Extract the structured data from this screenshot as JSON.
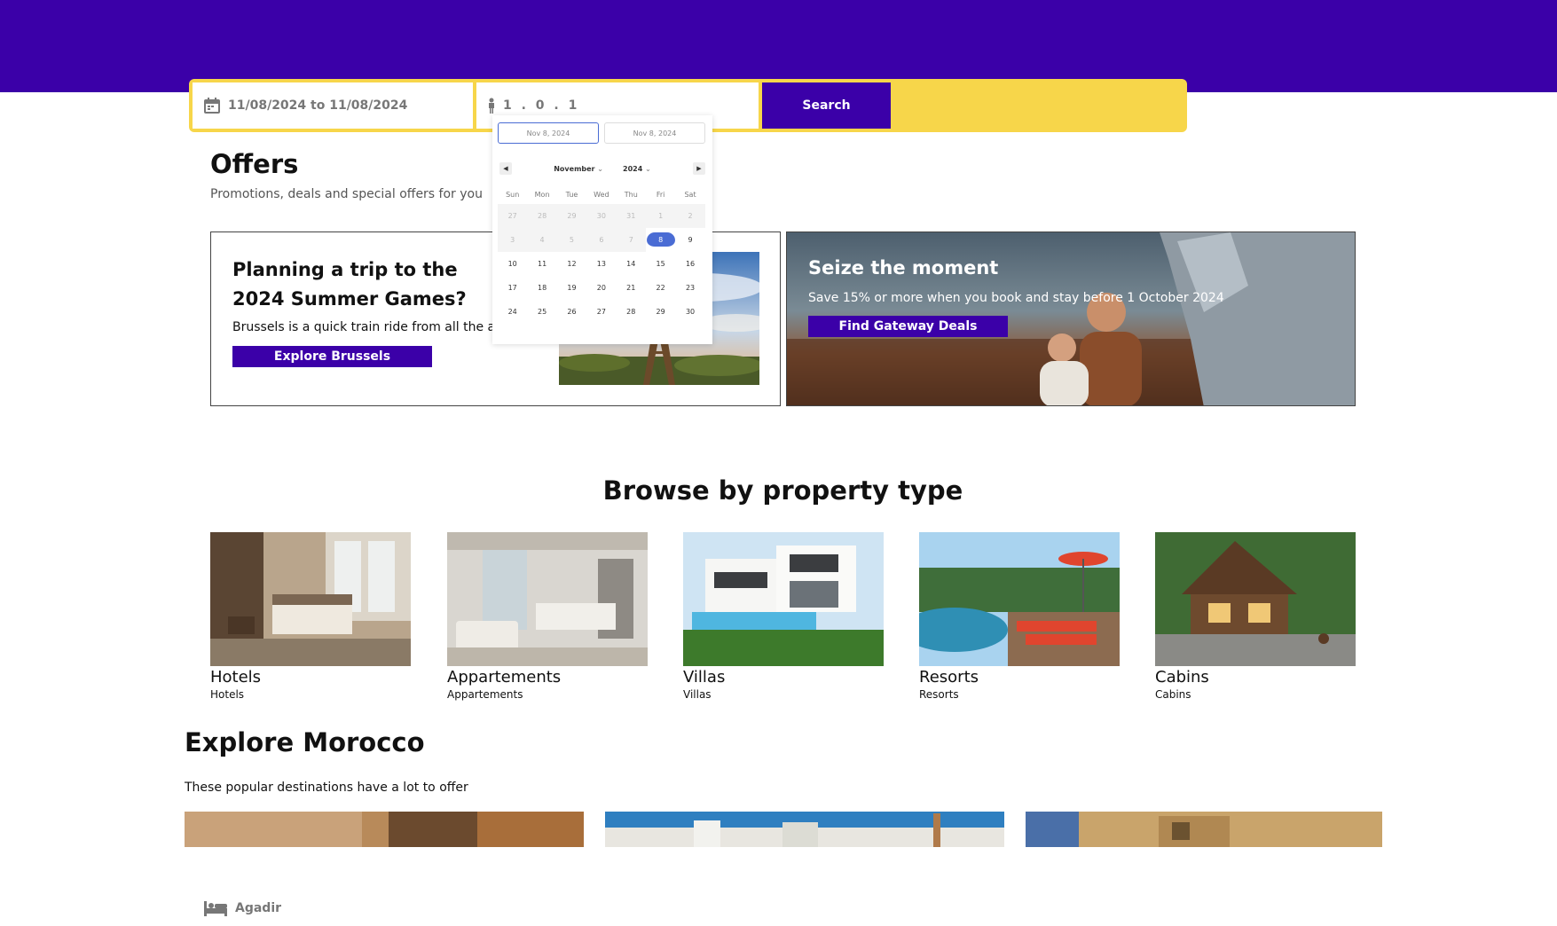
{
  "search": {
    "destination": "Agadir",
    "dates": "11/08/2024 to 11/08/2024",
    "guests": "1 . 0 . 1",
    "button": "Search"
  },
  "calendar": {
    "start_input": "Nov 8, 2024",
    "end_input": "Nov 8, 2024",
    "month": "November",
    "year": "2024",
    "weekdays": [
      "Sun",
      "Mon",
      "Tue",
      "Wed",
      "Thu",
      "Fri",
      "Sat"
    ],
    "days": [
      "27",
      "28",
      "29",
      "30",
      "31",
      "1",
      "2",
      "3",
      "4",
      "5",
      "6",
      "7",
      "8",
      "9",
      "10",
      "11",
      "12",
      "13",
      "14",
      "15",
      "16",
      "17",
      "18",
      "19",
      "20",
      "21",
      "22",
      "23",
      "24",
      "25",
      "26",
      "27",
      "28",
      "29",
      "30"
    ],
    "disabled_count": 12,
    "selected_day": "8"
  },
  "offers": {
    "title": "Offers",
    "subtitle": "Promotions, deals and special offers for you",
    "card1": {
      "title": "Planning a trip to the 2024 Summer Games?",
      "text": "Brussels is a quick train ride from all the act",
      "button": "Explore Brussels"
    },
    "card2": {
      "title": "Seize the moment",
      "text": "Save 15% or more when you book and stay before 1 October 2024",
      "button": "Find Gateway Deals"
    }
  },
  "browse": {
    "title": "Browse by property type",
    "types": [
      {
        "name": "Hotels",
        "sub": "Hotels"
      },
      {
        "name": "Appartements",
        "sub": "Appartements"
      },
      {
        "name": "Villas",
        "sub": "Villas"
      },
      {
        "name": "Resorts",
        "sub": "Resorts"
      },
      {
        "name": "Cabins",
        "sub": "Cabins"
      }
    ]
  },
  "explore": {
    "title": "Explore Morocco",
    "subtitle": "These popular destinations have a lot to offer"
  },
  "colors": {
    "brand": "#3b00a8",
    "search_border": "#f7d64a",
    "calendar_accent": "#4a6cd4"
  }
}
